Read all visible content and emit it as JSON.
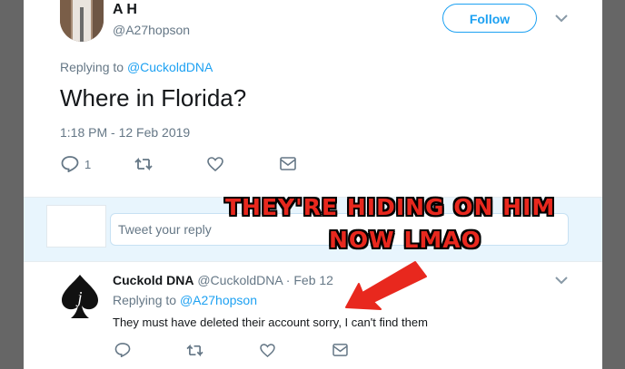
{
  "tweet": {
    "author_name": "A H",
    "author_handle": "@A27hopson",
    "follow_label": "Follow",
    "replying_prefix": "Replying to ",
    "replying_to": "@CuckoldDNA",
    "text": "Where in Florida?",
    "timestamp": "1:18 PM - 12 Feb 2019",
    "reply_count": "1"
  },
  "reply_box": {
    "placeholder": "Tweet your reply"
  },
  "reply": {
    "author_name": "Cuckold DNA",
    "meta": " @CuckoldDNA · Feb 12",
    "replying_prefix": "Replying to ",
    "replying_to": "@A27hopson",
    "text": "They must have deleted their account sorry, I can't find them"
  },
  "overlay": {
    "line1": "THEY'RE HIDING ON HIM",
    "line2": "NOW LMAO"
  },
  "colors": {
    "accent": "#1da1f2",
    "overlay_red": "#e8281e"
  },
  "icons": [
    "reply-icon",
    "retweet-icon",
    "like-icon",
    "message-icon",
    "chevron-down-icon",
    "arrow-annotation"
  ]
}
